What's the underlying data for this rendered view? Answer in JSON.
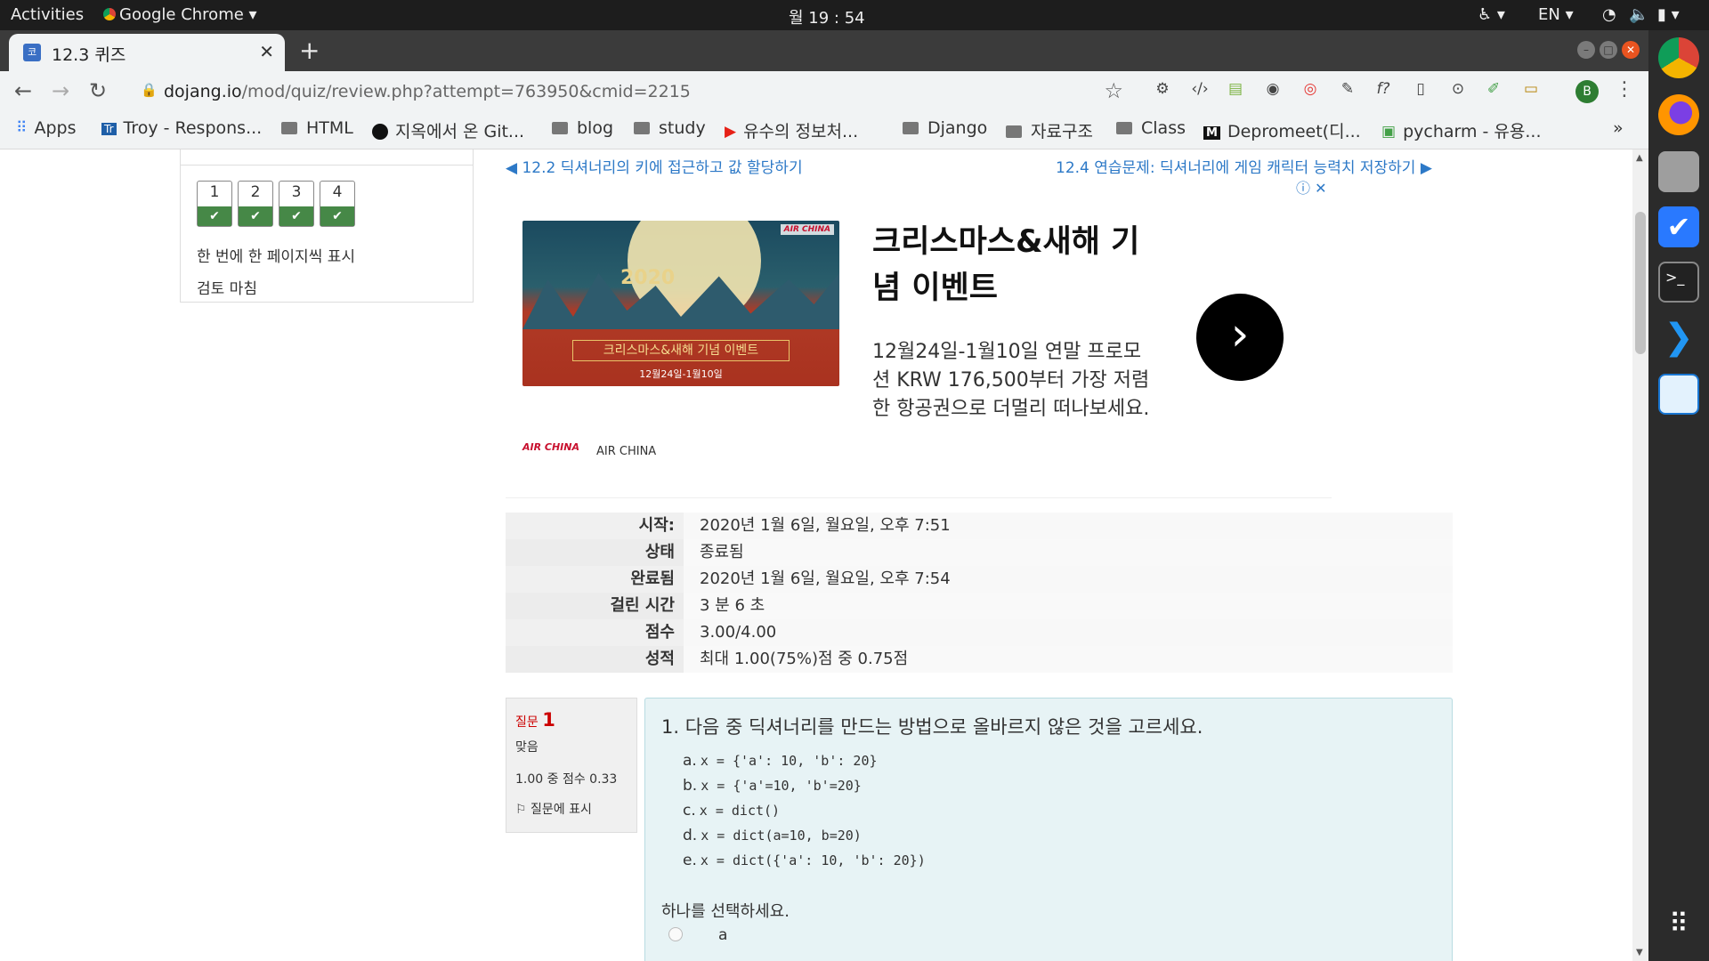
{
  "topbar": {
    "activities": "Activities",
    "app": "Google Chrome",
    "clock": "월 19 : 54",
    "lang": "EN"
  },
  "tab": {
    "title": "12.3 퀴즈",
    "favicon_text": "코"
  },
  "toolbar": {
    "url_domain": "dojang.io",
    "url_path": "/mod/quiz/review.php?attempt=763950&cmid=2215",
    "profile_initial": "B"
  },
  "bookmarks": [
    {
      "label": "Apps"
    },
    {
      "label": "Troy - Respons..."
    },
    {
      "label": "HTML"
    },
    {
      "label": "지옥에서 온 Git..."
    },
    {
      "label": "blog"
    },
    {
      "label": "study"
    },
    {
      "label": "유수의 정보처..."
    },
    {
      "label": "Django"
    },
    {
      "label": "자료구조"
    },
    {
      "label": "Class"
    },
    {
      "label": "Depromeet(디..."
    },
    {
      "label": "pycharm - 유용..."
    }
  ],
  "bookmarks_more": "»",
  "quiz_nav": {
    "buttons": [
      "1",
      "2",
      "3",
      "4"
    ],
    "show_one_page": "한 번에 한 페이지씩 표시",
    "finish_review": "검토 마침"
  },
  "prev_link": "◀ 12.2 딕셔너리의 키에 접근하고 값 할당하기",
  "next_link": "12.4 연습문제: 딕셔너리에 게임 캐릭터 능력치 저장하기 ▶",
  "ad": {
    "image_year": "2020",
    "image_banner": "크리스마스&새해 기념 이벤트",
    "image_dates": "12월24일-1월10일",
    "image_logo": "AIR CHINA",
    "headline": "크리스마스&새해 기념 이벤트",
    "body": "12월24일-1월10일 연말 프로모션 KRW 176,500부터 가장 저렴한 항공권으로 더멀리 떠나보세요.",
    "advertiser": "AIR CHINA",
    "logo_text": "AIR CHINA",
    "choices": "ⓘ ✕"
  },
  "summary": [
    {
      "key": "시작:",
      "value": "2020년 1월 6일, 월요일, 오후 7:51"
    },
    {
      "key": "상태",
      "value": "종료됨"
    },
    {
      "key": "완료됨",
      "value": "2020년 1월 6일, 월요일, 오후 7:54"
    },
    {
      "key": "걸린 시간",
      "value": "3 분 6 초"
    },
    {
      "key": "점수",
      "value": "3.00/4.00"
    },
    {
      "key": "성적",
      "value": "최대 1.00(75%)점 중 0.75점"
    }
  ],
  "question": {
    "label": "질문",
    "number": "1",
    "status": "맞음",
    "score": "1.00 중 점수 0.33",
    "flag": "질문에 표시",
    "text": "1. 다음 중 딕셔너리를 만드는 방법으로 올바르지 않은 것을 고르세요.",
    "answers": [
      {
        "letter": "a.",
        "code": "x = {'a': 10, 'b': 20}"
      },
      {
        "letter": "b.",
        "code": "x = {'a'=10, 'b'=20}"
      },
      {
        "letter": "c.",
        "code": "x = dict()"
      },
      {
        "letter": "d.",
        "code": "x = dict(a=10, b=20)"
      },
      {
        "letter": "e.",
        "code": "x = dict({'a': 10, 'b': 20})"
      }
    ],
    "prompt": "하나를 선택하세요.",
    "choice_a": "a"
  },
  "colors": {
    "correct_green": "#468847",
    "link_blue": "#2d79c7",
    "question_bg": "#e7f3f5"
  }
}
